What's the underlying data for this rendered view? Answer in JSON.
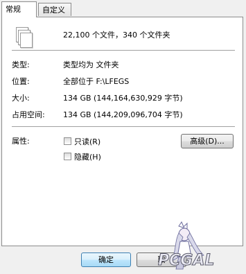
{
  "tabs": {
    "general": "常规",
    "custom": "自定义"
  },
  "summary": "22,100 个文件，340 个文件夹",
  "rows": {
    "type_label": "类型:",
    "type_value": "类型均为 文件夹",
    "location_label": "位置:",
    "location_value": "全部位于 F:\\LFEGS",
    "size_label": "大小:",
    "size_value": "134 GB (144,164,630,929 字节)",
    "disk_size_label": "占用空间:",
    "disk_size_value": "134 GB (144,209,096,704 字节)"
  },
  "attributes": {
    "label": "属性:",
    "readonly": "只读(R)",
    "hidden": "隐藏(H)",
    "advanced_button": "高级(D)..."
  },
  "buttons": {
    "ok": "确定",
    "cancel": "取"
  },
  "watermark_text": "PCGAL",
  "colors": {
    "panel_border": "#8c8c8c",
    "default_button_border": "#3c7fb1"
  }
}
